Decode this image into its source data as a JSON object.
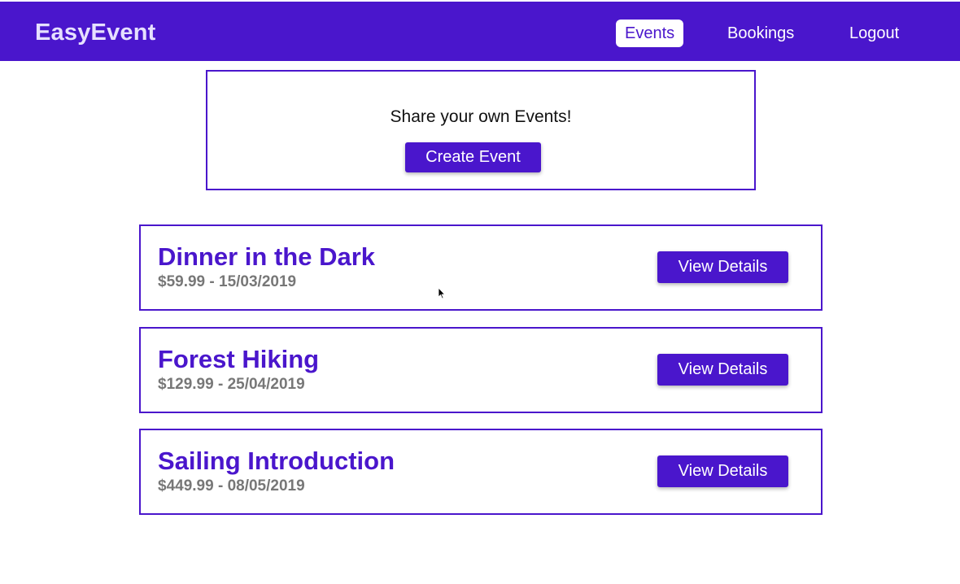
{
  "header": {
    "brand": "EasyEvent",
    "brand_color": "#4a16cc",
    "nav": [
      {
        "label": "Events",
        "active": true
      },
      {
        "label": "Bookings",
        "active": false
      },
      {
        "label": "Logout",
        "active": false
      }
    ]
  },
  "create_panel": {
    "prompt": "Share your own Events!",
    "button_label": "Create Event"
  },
  "events": [
    {
      "title": "Dinner in the Dark",
      "meta": "$59.99 - 15/03/2019",
      "button_label": "View Details"
    },
    {
      "title": "Forest Hiking",
      "meta": "$129.99 - 25/04/2019",
      "button_label": "View Details"
    },
    {
      "title": "Sailing Introduction",
      "meta": "$449.99 - 08/05/2019",
      "button_label": "View Details"
    }
  ],
  "icons": {
    "cursor": "mouse-pointer-icon"
  }
}
